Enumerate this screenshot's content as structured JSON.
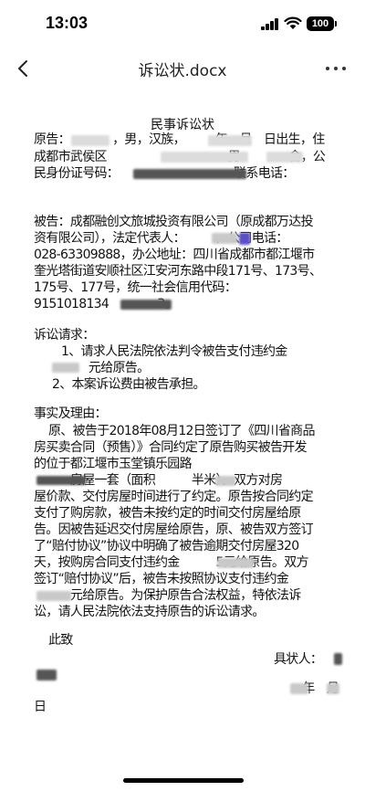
{
  "status_bar": {
    "time": "13:03",
    "battery": "100"
  },
  "nav": {
    "title": "诉讼状.docx",
    "back_icon": "chevron-left-icon",
    "more_icon": "more-horizontal-icon"
  },
  "doc": {
    "title": "民事诉讼状",
    "lines": [
      {
        "text": "原告：　　　　，男，汉族，　　　年　月　日出生，住"
      },
      {
        "text": "成都市武侯区　　　　　　　　　　男　　　　舍，公"
      },
      {
        "text": "民身份证号码：　　　　　　　　　　联系电话："
      },
      {
        "text": "被告：成都融创文旅城投资有限公司（原成都万达投"
      },
      {
        "text": "资有限公司），法定代表人：　　　，公司电话："
      },
      {
        "text": "028-63309888，办公地址：四川省成都市都江堰市"
      },
      {
        "text": "奎光塔街道安顺社区江安河东路中段171号、173号、"
      },
      {
        "text": "175号、177号，统一社会信用代码："
      },
      {
        "text": "9151018134　　　　3。"
      },
      {
        "text": "诉讼请求："
      },
      {
        "text": "1、请求人民法院依法判令被告支付违约金"
      },
      {
        "text": "　　　元给原告。"
      },
      {
        "text": "2、本案诉讼费由被告承担。"
      },
      {
        "text": "事实及理由："
      },
      {
        "text": "原、被告于2018年08月12日签订了《四川省商品"
      },
      {
        "text": "房买卖合同（预售）》合同约定了原告购买被告开发"
      },
      {
        "text": "的位于都江堰市玉堂镇乐园路"
      },
      {
        "text": "　　　房屋一套（面积　　　半米）。双方对房"
      },
      {
        "text": "屋价款、交付房屋时间进行了约定。原告按合同约定"
      },
      {
        "text": "支付了购房款，被告未按约定的时间交付房屋给原"
      },
      {
        "text": "告。因被告延迟交付房屋给原告，原、被告双方签订"
      },
      {
        "text": "了“赔付协议”协议中明确了被告逾期交付房屋320"
      },
      {
        "text": "天，按购房合同支付违约金　　　5元给原告。双方"
      },
      {
        "text": "签订“赔付协议”后，被告未按照协议支付违约金"
      },
      {
        "text": "　　　元给原告。为保护原告合法权益，特依法诉"
      },
      {
        "text": "讼，请人民法院依法支持原告的诉讼请求。"
      },
      {
        "text": "此致"
      },
      {
        "text": "具状人："
      },
      {
        "text": "　年　月"
      },
      {
        "text": "日"
      }
    ]
  }
}
